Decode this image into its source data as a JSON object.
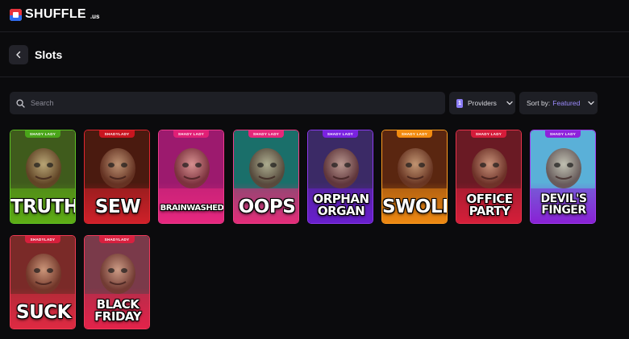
{
  "header": {
    "logo_text": "SHUFFLE",
    "logo_tld": ".us"
  },
  "page": {
    "title": "Slots",
    "back_icon": "chevron-left-icon"
  },
  "filters": {
    "search_placeholder": "Search",
    "providers_count": "1",
    "providers_label": "Providers",
    "sort_label": "Sort by:",
    "sort_value": "Featured"
  },
  "games": [
    {
      "name": "TRUTH",
      "provider": "SHADY LADY",
      "bg_top": "#3f5b1c",
      "bg_bottom": "#5fae16",
      "badge": "#4aa51a",
      "border": "#5ec124"
    },
    {
      "name": "SEW",
      "provider": "SHADYLADY",
      "bg_top": "#4a1a0f",
      "bg_bottom": "#d2202a",
      "badge": "#c8151f",
      "border": "#e22630"
    },
    {
      "name": "BRAINWASHED",
      "provider": "SHADY LADY",
      "bg_top": "#9c1a6e",
      "bg_bottom": "#e8287f",
      "badge": "#e01f76",
      "border": "#ef3b8c"
    },
    {
      "name": "OOPS",
      "provider": "SHADY LADY",
      "bg_top": "#1a6f6a",
      "bg_bottom": "#e72c7a",
      "badge": "#e5277a",
      "border": "#f03d87"
    },
    {
      "name": "ORPHAN ORGAN",
      "provider": "SHADY LADY",
      "bg_top": "#3b2a66",
      "bg_bottom": "#6a1fcf",
      "badge": "#7a22e0",
      "border": "#8d3af0"
    },
    {
      "name": "SWOLL",
      "provider": "SHADY LADY",
      "bg_top": "#5a2610",
      "bg_bottom": "#f08a12",
      "badge": "#f28a0f",
      "border": "#ff9d20"
    },
    {
      "name": "OFFICE PARTY",
      "provider": "SHADY LADY",
      "bg_top": "#6a1a24",
      "bg_bottom": "#d71f3a",
      "badge": "#d51c3a",
      "border": "#e8334c"
    },
    {
      "name": "DEVIL'S FINGER",
      "provider": "SHADY LADY",
      "bg_top": "#5ab0d8",
      "bg_bottom": "#8a1fd6",
      "badge": "#8d22db",
      "border": "#a13cf0"
    },
    {
      "name": "SUCK",
      "provider": "SHADYLADY",
      "bg_top": "#7a2a28",
      "bg_bottom": "#e02a43",
      "badge": "#d61f3c",
      "border": "#ee3a52"
    },
    {
      "name": "BLACK FRIDAY",
      "provider": "SHADYLADY",
      "bg_top": "#7a3a4a",
      "bg_bottom": "#e5234b",
      "badge": "#d8203f",
      "border": "#f0395a"
    }
  ]
}
